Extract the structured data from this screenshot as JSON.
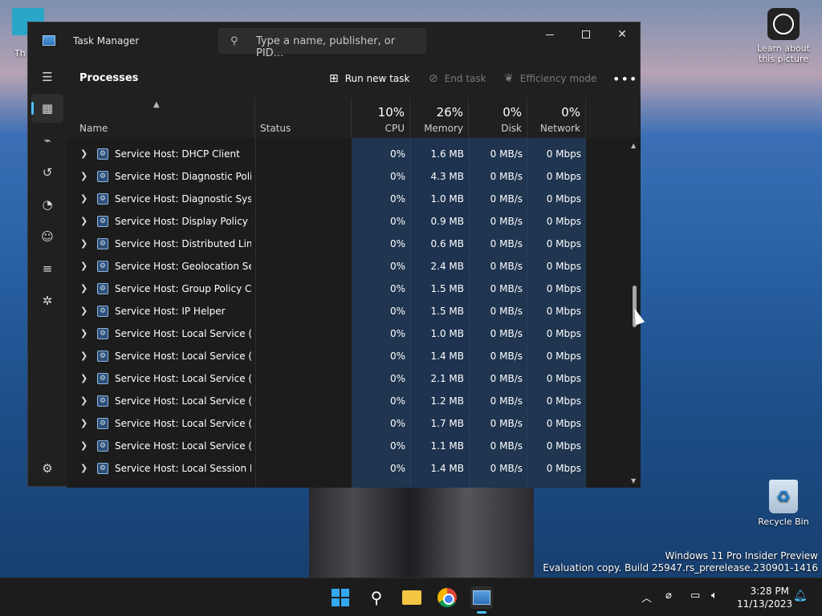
{
  "desktop": {
    "learn_label": "Learn about this picture",
    "recycle_label": "Recycle Bin",
    "this_pc_label": "Th",
    "watermark_line1": "Windows 11 Pro Insider Preview",
    "watermark_line2": "Evaluation copy. Build 25947.rs_prerelease.230901-1416"
  },
  "window": {
    "title": "Task Manager",
    "search_placeholder": "Type a name, publisher, or PID..."
  },
  "toolbar": {
    "page_title": "Processes",
    "run_new_task": "Run new task",
    "end_task": "End task",
    "efficiency_mode": "Efficiency mode",
    "more": "•••"
  },
  "columns": {
    "name": "Name",
    "status": "Status",
    "cpu_pct": "10%",
    "cpu": "CPU",
    "memory_pct": "26%",
    "memory": "Memory",
    "disk_pct": "0%",
    "disk": "Disk",
    "network_pct": "0%",
    "network": "Network"
  },
  "processes": [
    {
      "name": "Service Host: DHCP Client",
      "cpu": "0%",
      "memory": "1.6 MB",
      "disk": "0 MB/s",
      "network": "0 Mbps"
    },
    {
      "name": "Service Host: Diagnostic Polic...",
      "cpu": "0%",
      "memory": "4.3 MB",
      "disk": "0 MB/s",
      "network": "0 Mbps"
    },
    {
      "name": "Service Host: Diagnostic Syste...",
      "cpu": "0%",
      "memory": "1.0 MB",
      "disk": "0 MB/s",
      "network": "0 Mbps"
    },
    {
      "name": "Service Host: Display Policy Se...",
      "cpu": "0%",
      "memory": "0.9 MB",
      "disk": "0 MB/s",
      "network": "0 Mbps"
    },
    {
      "name": "Service Host: Distributed Link ...",
      "cpu": "0%",
      "memory": "0.6 MB",
      "disk": "0 MB/s",
      "network": "0 Mbps"
    },
    {
      "name": "Service Host: Geolocation Serv...",
      "cpu": "0%",
      "memory": "2.4 MB",
      "disk": "0 MB/s",
      "network": "0 Mbps"
    },
    {
      "name": "Service Host: Group Policy Cli...",
      "cpu": "0%",
      "memory": "1.5 MB",
      "disk": "0 MB/s",
      "network": "0 Mbps"
    },
    {
      "name": "Service Host: IP Helper",
      "cpu": "0%",
      "memory": "1.5 MB",
      "disk": "0 MB/s",
      "network": "0 Mbps"
    },
    {
      "name": "Service Host: Local Service (N...",
      "cpu": "0%",
      "memory": "1.0 MB",
      "disk": "0 MB/s",
      "network": "0 Mbps"
    },
    {
      "name": "Service Host: Local Service (N...",
      "cpu": "0%",
      "memory": "1.4 MB",
      "disk": "0 MB/s",
      "network": "0 Mbps"
    },
    {
      "name": "Service Host: Local Service (N...",
      "cpu": "0%",
      "memory": "2.1 MB",
      "disk": "0 MB/s",
      "network": "0 Mbps"
    },
    {
      "name": "Service Host: Local Service (N...",
      "cpu": "0%",
      "memory": "1.2 MB",
      "disk": "0 MB/s",
      "network": "0 Mbps"
    },
    {
      "name": "Service Host: Local Service (N...",
      "cpu": "0%",
      "memory": "1.7 MB",
      "disk": "0 MB/s",
      "network": "0 Mbps"
    },
    {
      "name": "Service Host: Local Service (N...",
      "cpu": "0%",
      "memory": "1.1 MB",
      "disk": "0 MB/s",
      "network": "0 Mbps"
    },
    {
      "name": "Service Host: Local Session M...",
      "cpu": "0%",
      "memory": "1.4 MB",
      "disk": "0 MB/s",
      "network": "0 Mbps"
    }
  ],
  "nav": [
    {
      "icon": "hamburger-icon"
    },
    {
      "icon": "processes-icon"
    },
    {
      "icon": "performance-icon"
    },
    {
      "icon": "app-history-icon"
    },
    {
      "icon": "startup-apps-icon"
    },
    {
      "icon": "users-icon"
    },
    {
      "icon": "details-icon"
    },
    {
      "icon": "services-icon"
    },
    {
      "icon": "settings-icon"
    }
  ],
  "taskbar": {
    "time": "3:28 PM",
    "date": "11/13/2023"
  },
  "colors": {
    "accent": "#4cc2ff",
    "window_bg": "#202020",
    "heat_column": "#1f3550"
  }
}
